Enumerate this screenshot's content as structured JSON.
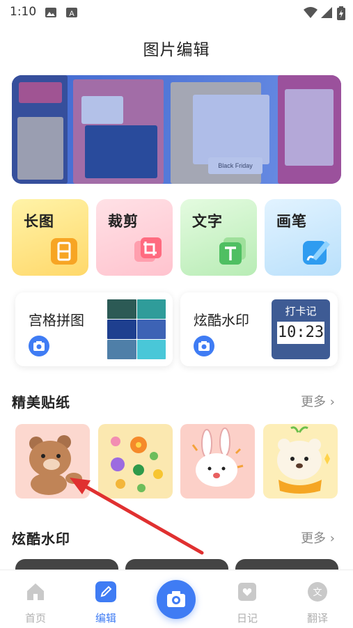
{
  "status_bar": {
    "time": "1:10"
  },
  "header": {
    "title": "图片编辑"
  },
  "banner": {
    "caption": "Black Friday"
  },
  "tools": [
    {
      "label": "长图",
      "icon": "long-image-icon"
    },
    {
      "label": "裁剪",
      "icon": "crop-icon"
    },
    {
      "label": "文字",
      "icon": "text-icon"
    },
    {
      "label": "画笔",
      "icon": "brush-icon"
    }
  ],
  "features": [
    {
      "label": "宫格拼图",
      "icon": "camera-icon"
    },
    {
      "label": "炫酷水印",
      "icon": "camera-icon",
      "stamp_title": "打卡记",
      "stamp_time": "10:23"
    }
  ],
  "stickers": {
    "title": "精美贴纸",
    "more": "更多"
  },
  "watermarks": {
    "title": "炫酷水印",
    "more": "更多"
  },
  "bottom_nav": {
    "items": [
      {
        "label": "首页",
        "icon": "home-icon"
      },
      {
        "label": "编辑",
        "icon": "edit-icon",
        "active": true
      },
      {
        "label": "",
        "icon": "camera-icon"
      },
      {
        "label": "日记",
        "icon": "diary-icon"
      },
      {
        "label": "翻译",
        "icon": "translate-icon"
      }
    ]
  },
  "colors": {
    "accent": "#3f7cf4",
    "annotation": "#e03030"
  }
}
